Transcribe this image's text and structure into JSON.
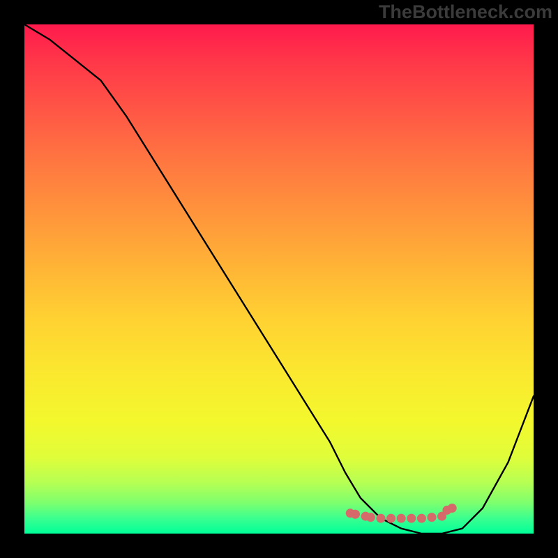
{
  "watermark": "TheBottleneck.com",
  "chart_data": {
    "type": "line",
    "title": "",
    "xlabel": "",
    "ylabel": "",
    "xlim": [
      0,
      100
    ],
    "ylim": [
      0,
      100
    ],
    "series": [
      {
        "name": "curve",
        "x": [
          0,
          5,
          10,
          15,
          20,
          25,
          30,
          35,
          40,
          45,
          50,
          55,
          60,
          63,
          66,
          70,
          74,
          78,
          82,
          86,
          90,
          95,
          100
        ],
        "y": [
          100,
          97,
          93,
          89,
          82,
          74,
          66,
          58,
          50,
          42,
          34,
          26,
          18,
          12,
          7,
          3,
          1,
          0,
          0,
          1,
          5,
          14,
          27
        ]
      }
    ],
    "markers": {
      "name": "minimum-markers",
      "color": "#d66a6a",
      "points": [
        {
          "x": 64,
          "y": 4.0
        },
        {
          "x": 65,
          "y": 3.8
        },
        {
          "x": 67,
          "y": 3.4
        },
        {
          "x": 68,
          "y": 3.2
        },
        {
          "x": 70,
          "y": 3.0
        },
        {
          "x": 72,
          "y": 3.0
        },
        {
          "x": 74,
          "y": 3.0
        },
        {
          "x": 76,
          "y": 3.0
        },
        {
          "x": 78,
          "y": 3.0
        },
        {
          "x": 80,
          "y": 3.2
        },
        {
          "x": 82,
          "y": 3.4
        },
        {
          "x": 83,
          "y": 4.6
        },
        {
          "x": 84,
          "y": 5.0
        }
      ]
    }
  }
}
